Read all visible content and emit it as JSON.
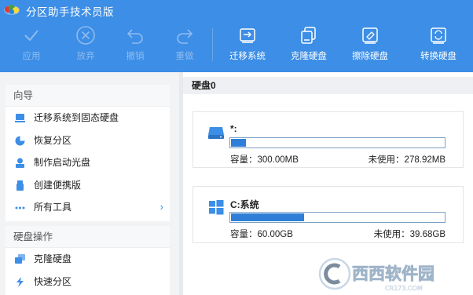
{
  "app": {
    "title": "分区助手技术员版"
  },
  "toolbar": {
    "apply": "应用",
    "discard": "放弃",
    "undo": "撤销",
    "redo": "重做",
    "migrate": "迁移系统",
    "clone": "克隆硬盘",
    "wipe": "擦除硬盘",
    "convert": "转换硬盘"
  },
  "sidebar": {
    "wizard_title": "向导",
    "wizard_items": [
      "迁移系统到固态硬盘",
      "恢复分区",
      "制作启动光盘",
      "创建便携版",
      "所有工具"
    ],
    "disk_ops_title": "硬盘操作",
    "disk_ops_items": [
      "克隆硬盘",
      "快速分区"
    ]
  },
  "main": {
    "disk_title": "硬盘0",
    "partitions": [
      {
        "name": "*:",
        "capacity": "容量：300.00MB",
        "free": "未使用：278.92MB",
        "used_fraction": 0.07
      },
      {
        "name": "C:系统",
        "capacity": "容量：60.00GB",
        "free": "未使用：39.68GB",
        "used_fraction": 0.34
      }
    ]
  },
  "watermark": {
    "text": "西西软件园",
    "sub": "CR173.COM"
  },
  "colors": {
    "accent": "#3c8ee6",
    "bar_fill": "#2f7fd8",
    "disabled_label": "#8fbcef"
  }
}
